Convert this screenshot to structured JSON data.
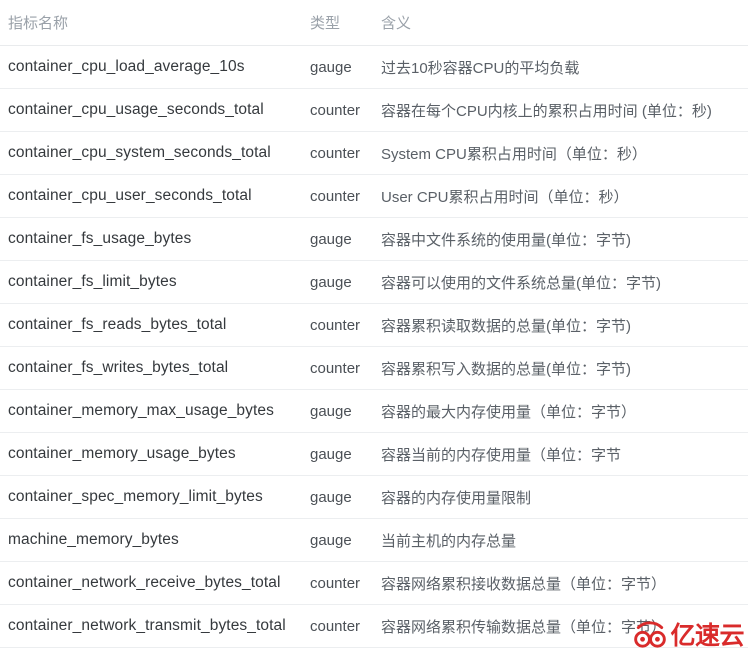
{
  "table": {
    "columns": [
      {
        "key": "name",
        "label": "指标名称"
      },
      {
        "key": "type",
        "label": "类型"
      },
      {
        "key": "desc",
        "label": "含义"
      }
    ],
    "rows": [
      {
        "name": "container_cpu_load_average_10s",
        "type": "gauge",
        "desc": "过去10秒容器CPU的平均负载"
      },
      {
        "name": "container_cpu_usage_seconds_total",
        "type": "counter",
        "desc": "容器在每个CPU内核上的累积占用时间 (单位：秒)"
      },
      {
        "name": "container_cpu_system_seconds_total",
        "type": "counter",
        "desc": "System CPU累积占用时间（单位：秒）"
      },
      {
        "name": "container_cpu_user_seconds_total",
        "type": "counter",
        "desc": "User CPU累积占用时间（单位：秒）"
      },
      {
        "name": "container_fs_usage_bytes",
        "type": "gauge",
        "desc": "容器中文件系统的使用量(单位：字节)"
      },
      {
        "name": "container_fs_limit_bytes",
        "type": "gauge",
        "desc": "容器可以使用的文件系统总量(单位：字节)"
      },
      {
        "name": "container_fs_reads_bytes_total",
        "type": "counter",
        "desc": "容器累积读取数据的总量(单位：字节)"
      },
      {
        "name": "container_fs_writes_bytes_total",
        "type": "counter",
        "desc": "容器累积写入数据的总量(单位：字节)"
      },
      {
        "name": "container_memory_max_usage_bytes",
        "type": "gauge",
        "desc": "容器的最大内存使用量（单位：字节）"
      },
      {
        "name": "container_memory_usage_bytes",
        "type": "gauge",
        "desc": "容器当前的内存使用量（单位：字节"
      },
      {
        "name": "container_spec_memory_limit_bytes",
        "type": "gauge",
        "desc": "容器的内存使用量限制"
      },
      {
        "name": "machine_memory_bytes",
        "type": "gauge",
        "desc": "当前主机的内存总量"
      },
      {
        "name": "container_network_receive_bytes_total",
        "type": "counter",
        "desc": "容器网络累积接收数据总量（单位：字节）"
      },
      {
        "name": "container_network_transmit_bytes_total",
        "type": "counter",
        "desc": "容器网络累积传输数据总量（单位：字节）"
      }
    ]
  },
  "watermark": {
    "text": "亿速云",
    "logo_icon": "cloud-swirl-icon",
    "color": "#d92b2b"
  }
}
